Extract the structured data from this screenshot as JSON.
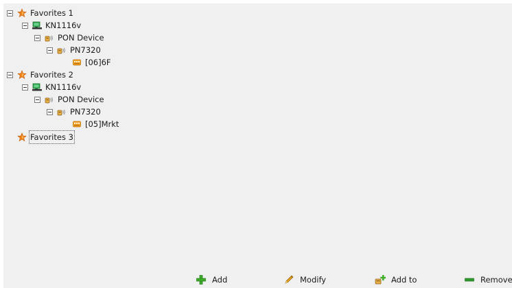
{
  "tree": {
    "fav1": {
      "label": "Favorites 1"
    },
    "fav1_kn": {
      "label": "KN1116v"
    },
    "fav1_pon": {
      "label": "PON Device"
    },
    "fav1_pn": {
      "label": "PN7320"
    },
    "fav1_onu": {
      "label": "[06]6F"
    },
    "fav2": {
      "label": "Favorites 2"
    },
    "fav2_kn": {
      "label": "KN1116v"
    },
    "fav2_pon": {
      "label": "PON Device"
    },
    "fav2_pn": {
      "label": "PN7320"
    },
    "fav2_onu": {
      "label": "[05]Mrkt"
    },
    "fav3": {
      "label": "Favorites 3"
    }
  },
  "toolbar": {
    "add_label": "Add",
    "modify_label": "Modify",
    "add_to_label": "Add to",
    "remove_label": "Remove"
  },
  "icons": {
    "favorite": "star-icon",
    "switch": "network-switch-icon",
    "pon_group": "pon-device-icon",
    "olt": "pon-device-icon",
    "onu": "onu-icon"
  },
  "colors": {
    "background": "#f0f0f0",
    "star": "#f0831c",
    "switch": "#2fa84f",
    "add": "#3fae2a",
    "modify": "#e9a520",
    "remove": "#2f9e2f"
  }
}
